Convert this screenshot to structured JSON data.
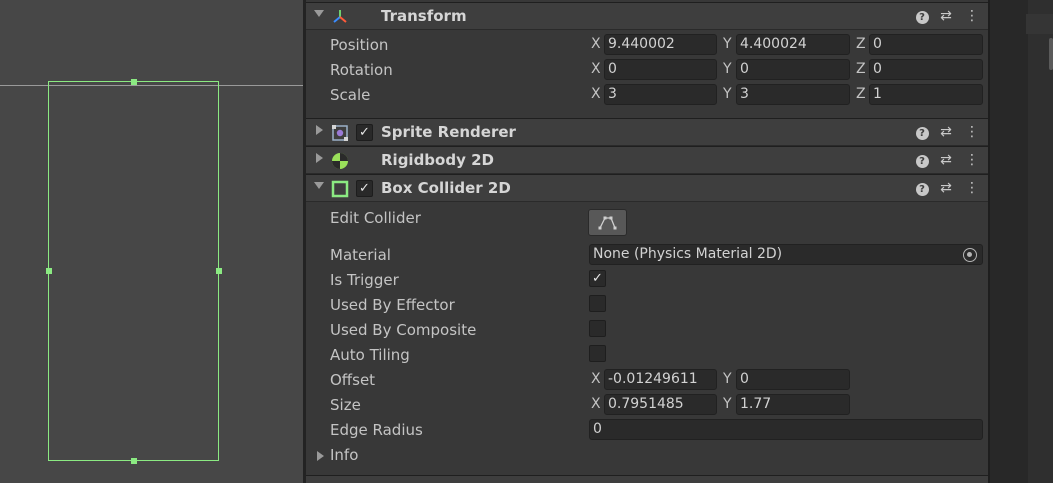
{
  "components": {
    "transform": {
      "title": "Transform",
      "icon": "transform-icon",
      "position": {
        "label": "Position",
        "x": "9.440002",
        "y": "4.400024",
        "z": "0"
      },
      "rotation": {
        "label": "Rotation",
        "x": "0",
        "y": "0",
        "z": "0"
      },
      "scale": {
        "label": "Scale",
        "x": "3",
        "y": "3",
        "z": "1"
      }
    },
    "sprite_renderer": {
      "title": "Sprite Renderer",
      "icon": "sprite-renderer-icon",
      "enabled": "✓"
    },
    "rigidbody": {
      "title": "Rigidbody 2D",
      "icon": "rigidbody-icon"
    },
    "box_collider": {
      "title": "Box Collider 2D",
      "icon": "box-collider-icon",
      "enabled": "✓",
      "edit_collider": {
        "label": "Edit Collider",
        "icon": "edit-collider-icon"
      },
      "material": {
        "label": "Material",
        "value": "None (Physics Material 2D)"
      },
      "is_trigger": {
        "label": "Is Trigger",
        "checked": "✓"
      },
      "used_by_effector": {
        "label": "Used By Effector",
        "checked": ""
      },
      "used_by_composite": {
        "label": "Used By Composite",
        "checked": ""
      },
      "auto_tiling": {
        "label": "Auto Tiling",
        "checked": ""
      },
      "offset": {
        "label": "Offset",
        "x": "-0.01249611",
        "y": "0"
      },
      "size": {
        "label": "Size",
        "x": "0.7951485",
        "y": "1.77"
      },
      "edge_radius": {
        "label": "Edge Radius",
        "value": "0"
      },
      "info": {
        "label": "Info"
      }
    }
  },
  "axes": {
    "x": "X",
    "y": "Y",
    "z": "Z"
  },
  "header_buttons": {
    "help": "?",
    "preset": "⇄",
    "more": "⋮"
  },
  "colors": {
    "collider_gizmo": "#8bea82",
    "box_collider_icon": "#8bea82"
  }
}
